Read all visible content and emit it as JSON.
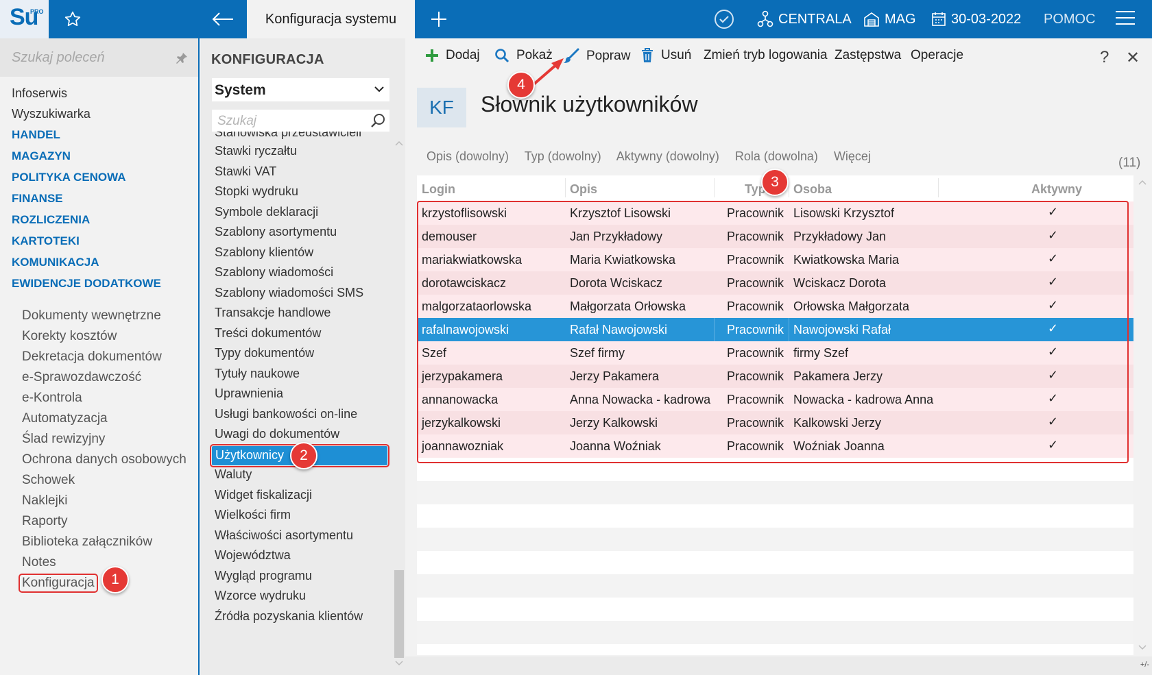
{
  "app": {
    "logo_text": "Su",
    "logo_pro": "PRO",
    "active_tab": "Konfiguracja systemu",
    "company": "CENTRALA",
    "warehouse": "MAG",
    "date": "30-03-2022",
    "help": "POMOC",
    "accent": "#0a6db7"
  },
  "sidebar": {
    "search_placeholder": "Szukaj poleceń",
    "top_items": [
      "Infoserwis",
      "Wyszukiwarka"
    ],
    "sections": [
      "HANDEL",
      "MAGAZYN",
      "POLITYKA CENOWA",
      "FINANSE",
      "ROZLICZENIA",
      "KARTOTEKI",
      "KOMUNIKACJA",
      "EWIDENCJE DODATKOWE"
    ],
    "sub_items": [
      "Dokumenty wewnętrzne",
      "Korekty kosztów",
      "Dekretacja dokumentów",
      "e-Sprawozdawczość",
      "e-Kontrola",
      "Automatyzacja",
      "Ślad rewizyjny",
      "Ochrona danych osobowych",
      "Schowek",
      "Naklejki",
      "Raporty",
      "Biblioteka załączników",
      "Notes",
      "Konfiguracja"
    ]
  },
  "config": {
    "title": "KONFIGURACJA",
    "select_value": "System",
    "search_placeholder": "Szukaj",
    "items": [
      "Stanowiska przedstawicieli",
      "Stawki ryczałtu",
      "Stawki VAT",
      "Stopki wydruku",
      "Symbole deklaracji",
      "Szablony asortymentu",
      "Szablony klientów",
      "Szablony wiadomości",
      "Szablony wiadomości SMS",
      "Transakcje handlowe",
      "Treści dokumentów",
      "Typy dokumentów",
      "Tytuły naukowe",
      "Uprawnienia",
      "Usługi bankowości on-line",
      "Uwagi do dokumentów",
      "Użytkownicy",
      "Waluty",
      "Widget fiskalizacji",
      "Wielkości firm",
      "Właściwości asortymentu",
      "Województwa",
      "Wygląd programu",
      "Wzorce wydruku",
      "Źródła pozyskania klientów"
    ],
    "selected": "Użytkownicy"
  },
  "toolbar": {
    "add": "Dodaj",
    "show": "Pokaż",
    "edit": "Popraw",
    "delete": "Usuń",
    "login_mode": "Zmień tryb logowania",
    "substitutes": "Zastępstwa",
    "operations": "Operacje",
    "help": "?",
    "close": "✕"
  },
  "page": {
    "badge": "KF",
    "title": "Słownik użytkowników",
    "filters": [
      "Opis (dowolny)",
      "Typ (dowolny)",
      "Aktywny (dowolny)",
      "Rola (dowolna)",
      "Więcej"
    ],
    "count": "(11)"
  },
  "table": {
    "columns": [
      "Login",
      "Opis",
      "Typ",
      "Osoba",
      "Aktywny"
    ],
    "rows": [
      {
        "login": "krzystoflisowski",
        "opis": "Krzysztof Lisowski",
        "typ": "Pracownik",
        "osoba": "Lisowski Krzysztof",
        "aktywny": "✓"
      },
      {
        "login": "demouser",
        "opis": "Jan Przykładowy",
        "typ": "Pracownik",
        "osoba": "Przykładowy Jan",
        "aktywny": "✓"
      },
      {
        "login": "mariakwiatkowska",
        "opis": "Maria Kwiatkowska",
        "typ": "Pracownik",
        "osoba": "Kwiatkowska Maria",
        "aktywny": "✓"
      },
      {
        "login": "dorotawciskacz",
        "opis": "Dorota Wciskacz",
        "typ": "Pracownik",
        "osoba": "Wciskacz Dorota",
        "aktywny": "✓"
      },
      {
        "login": "malgorzataorlowska",
        "opis": "Małgorzata Orłowska",
        "typ": "Pracownik",
        "osoba": "Orłowska Małgorzata",
        "aktywny": "✓"
      },
      {
        "login": "rafalnawojowski",
        "opis": "Rafał Nawojowski",
        "typ": "Pracownik",
        "osoba": "Nawojowski Rafał",
        "aktywny": "✓"
      },
      {
        "login": "Szef",
        "opis": "Szef firmy",
        "typ": "Pracownik",
        "osoba": "firmy Szef",
        "aktywny": "✓"
      },
      {
        "login": "jerzypakamera",
        "opis": "Jerzy Pakamera",
        "typ": "Pracownik",
        "osoba": "Pakamera Jerzy",
        "aktywny": "✓"
      },
      {
        "login": "annanowacka",
        "opis": "Anna Nowacka - kadrowa",
        "typ": "Pracownik",
        "osoba": "Nowacka - kadrowa Anna",
        "aktywny": "✓"
      },
      {
        "login": "jerzykalkowski",
        "opis": "Jerzy Kalkowski",
        "typ": "Pracownik",
        "osoba": "Kalkowski Jerzy",
        "aktywny": "✓"
      },
      {
        "login": "joannawozniak",
        "opis": "Joanna Woźniak",
        "typ": "Pracownik",
        "osoba": "Woźniak Joanna",
        "aktywny": "✓"
      }
    ],
    "selected_row": 5
  },
  "statusbar": {
    "text": "+/-"
  },
  "annotations": [
    "1",
    "2",
    "3",
    "4"
  ]
}
